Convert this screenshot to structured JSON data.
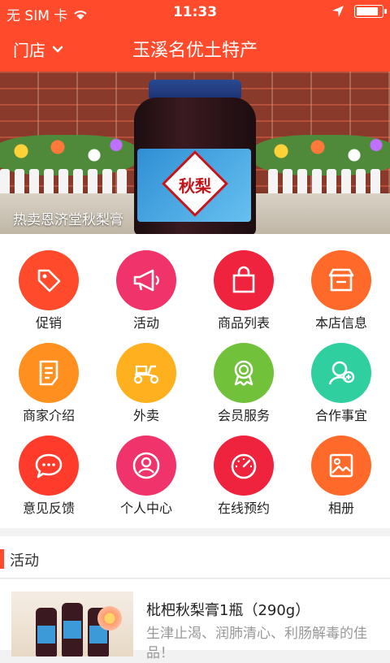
{
  "status_bar": {
    "carrier": "无 SIM 卡",
    "time": "11:33",
    "battery_level": 0.9,
    "icons": [
      "wifi-icon",
      "location-arrow-icon",
      "battery-icon"
    ]
  },
  "nav": {
    "store_label": "门店",
    "title": "玉溪名优土特产"
  },
  "banner": {
    "caption": "热卖恩济堂秋梨膏",
    "jar_label": "秋梨"
  },
  "menu": [
    {
      "label": "促销",
      "icon": "tag-icon",
      "color": "#ff4a2b"
    },
    {
      "label": "活动",
      "icon": "megaphone-icon",
      "color": "#f0336a"
    },
    {
      "label": "商品列表",
      "icon": "shopping-bag-icon",
      "color": "#f0233e"
    },
    {
      "label": "本店信息",
      "icon": "storefront-icon",
      "color": "#ff6a2b"
    },
    {
      "label": "商家介绍",
      "icon": "document-icon",
      "color": "#ff8f1f"
    },
    {
      "label": "外卖",
      "icon": "scooter-icon",
      "color": "#ffb01f"
    },
    {
      "label": "会员服务",
      "icon": "award-badge-icon",
      "color": "#72c13b"
    },
    {
      "label": "合作事宜",
      "icon": "add-contact-icon",
      "color": "#2fcf9f"
    },
    {
      "label": "意见反馈",
      "icon": "chat-bubble-icon",
      "color": "#ff3b2b"
    },
    {
      "label": "个人中心",
      "icon": "user-profile-icon",
      "color": "#f0336a"
    },
    {
      "label": "在线预约",
      "icon": "speedometer-icon",
      "color": "#f0233e"
    },
    {
      "label": "相册",
      "icon": "photo-album-icon",
      "color": "#ff6a2b"
    }
  ],
  "section": {
    "title": "活动"
  },
  "product": {
    "name": "枇杷秋梨膏1瓶（290g）",
    "description": "生津止渴、润肺清心、利肠解毒的佳品！"
  },
  "colors": {
    "brand": "#ff4a2b"
  }
}
